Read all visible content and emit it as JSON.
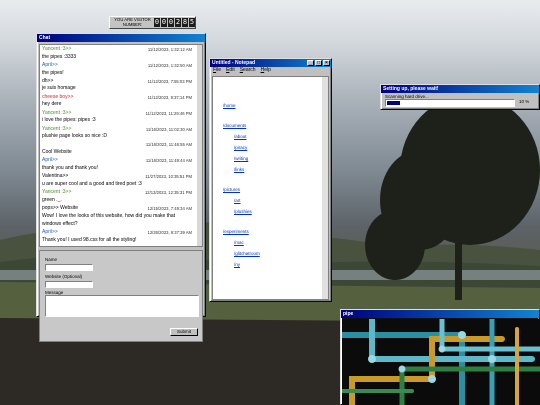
{
  "visitor_counter": {
    "label": "YOU ARE VISITOR NUMBER:",
    "digits": [
      "0",
      "0",
      "0",
      "2",
      "8",
      "5"
    ]
  },
  "chat": {
    "title": "Chat",
    "messages": [
      {
        "user": "Yancent :3>>",
        "user_color": "green",
        "text": "",
        "time": "11/12/2023, 1:32:12 AM"
      },
      {
        "user": "",
        "user_color": "",
        "text": "the pipes :3333",
        "time": ""
      },
      {
        "user": "April>>",
        "user_color": "blue",
        "text": "",
        "time": "11/12/2023, 1:32:50 AM"
      },
      {
        "user": "",
        "user_color": "",
        "text": "the pipes!",
        "time": ""
      },
      {
        "user": "",
        "user_color": "",
        "text": "dh>>",
        "time": "11/12/2023, 7:55:03 PM"
      },
      {
        "user": "",
        "user_color": "",
        "text": "je suis homage",
        "time": ""
      },
      {
        "user": "cheese boy>>",
        "user_color": "red",
        "text": "",
        "time": "11/12/2023, 9:37:14 PM"
      },
      {
        "user": "",
        "user_color": "",
        "text": "hey dere",
        "time": ""
      },
      {
        "user": "Yancent :3>>",
        "user_color": "green",
        "text": "",
        "time": "11/12/2023, 11:29:46 PM"
      },
      {
        "user": "",
        "user_color": "",
        "text": "i love the pipes: pipes :3",
        "time": ""
      },
      {
        "user": "Yancent :3>>",
        "user_color": "green",
        "text": "",
        "time": "11/16/2023, 11:02:30 AM"
      },
      {
        "user": "",
        "user_color": "",
        "text": "plushie page looks so nice :D",
        "time": ""
      },
      {
        "user": "",
        "user_color": "",
        "text": "",
        "time": "11/16/2023, 11:46:55 AM"
      },
      {
        "user": "",
        "user_color": "",
        "text": "Cool Website",
        "time": ""
      },
      {
        "user": "April>>",
        "user_color": "blue",
        "text": "",
        "time": "11/16/2023, 11:49:44 AM"
      },
      {
        "user": "",
        "user_color": "",
        "text": "thank you and thank you!",
        "time": ""
      },
      {
        "user": "",
        "user_color": "",
        "text": "Valentina>>",
        "time": "11/27/2023, 10:35:51 PM"
      },
      {
        "user": "",
        "user_color": "",
        "text": "u are super cool and a good and tired poet :3",
        "time": ""
      },
      {
        "user": "Yancent :3>>",
        "user_color": "green",
        "text": "",
        "time": "12/13/2023, 12:35:31 PM"
      },
      {
        "user": "",
        "user_color": "",
        "text": "green ._.",
        "time": ""
      },
      {
        "user": "",
        "user_color": "",
        "text": "pops>> Website",
        "time": "12/15/2023, 7:49:34 AM"
      },
      {
        "user": "",
        "user_color": "",
        "text": "Wow! I love the looks of this website, how did you make that",
        "time": ""
      },
      {
        "user": "",
        "user_color": "",
        "text": "windows effect?",
        "time": ""
      },
      {
        "user": "April>>",
        "user_color": "blue",
        "text": "",
        "time": "12/26/2023, 9:37:39 AM"
      },
      {
        "user": "",
        "user_color": "",
        "text": "Thank you! I used 98.css for all the styling!",
        "time": ""
      }
    ],
    "form": {
      "name_label": "Name",
      "website_label": "Website (Optional)",
      "message_label": "Message",
      "submit_label": "Submit"
    }
  },
  "notepad": {
    "title": "Untitled - Notepad",
    "menu": [
      "File",
      "Edit",
      "Search",
      "Help"
    ],
    "links": [
      "/home",
      "/documents",
      "/about",
      "/piracy",
      "/writing",
      "/links",
      "/pictures",
      "/art",
      "/plushies",
      "/experiments",
      "/mac",
      "/glitchatroom",
      "/ny"
    ]
  },
  "setup": {
    "title": "Setting up, please wait!",
    "status": "Scanning hard drive...",
    "percent_label": "10 %",
    "progress": 0.1
  },
  "pipe": {
    "title": "pipe"
  }
}
